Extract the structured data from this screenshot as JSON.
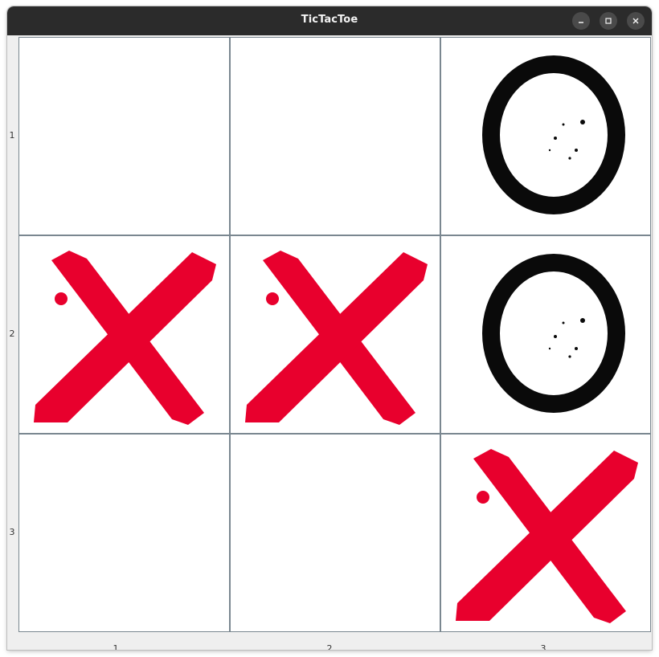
{
  "window": {
    "title": "TicTacToe",
    "controls": {
      "minimize_icon": "minimize-icon",
      "maximize_icon": "maximize-icon",
      "close_icon": "close-icon"
    }
  },
  "board": {
    "row_labels": [
      "1",
      "2",
      "3"
    ],
    "col_labels": [
      "1",
      "2",
      "3"
    ],
    "cells": [
      [
        "",
        "",
        "O"
      ],
      [
        "X",
        "X",
        "O"
      ],
      [
        "",
        "",
        "X"
      ]
    ],
    "colors": {
      "x_mark": "#e8002d",
      "o_mark": "#0a0a0a",
      "grid_line": "#7a8790",
      "titlebar": "#2b2b2b"
    }
  }
}
